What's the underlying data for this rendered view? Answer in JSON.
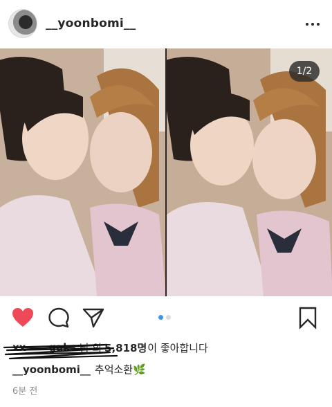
{
  "header": {
    "username": "__yoonbomi__"
  },
  "media": {
    "counter": "1/2",
    "slide_count": 2,
    "active_slide": 1
  },
  "likes": {
    "liker": "xx_ __ gak_",
    "suffix1": "님 외",
    "count": "5,818명",
    "suffix2": "이 좋아합니다"
  },
  "caption": {
    "username": "__yoonbomi__",
    "text": "추억소환",
    "emoji": "🌿"
  },
  "time": "6분 전",
  "colors": {
    "heart": "#ed4956",
    "dot_active": "#3897f0",
    "dot_inactive": "#dbdbdb"
  },
  "icons": [
    "more-icon",
    "heart-icon",
    "comment-icon",
    "share-icon",
    "bookmark-icon"
  ]
}
